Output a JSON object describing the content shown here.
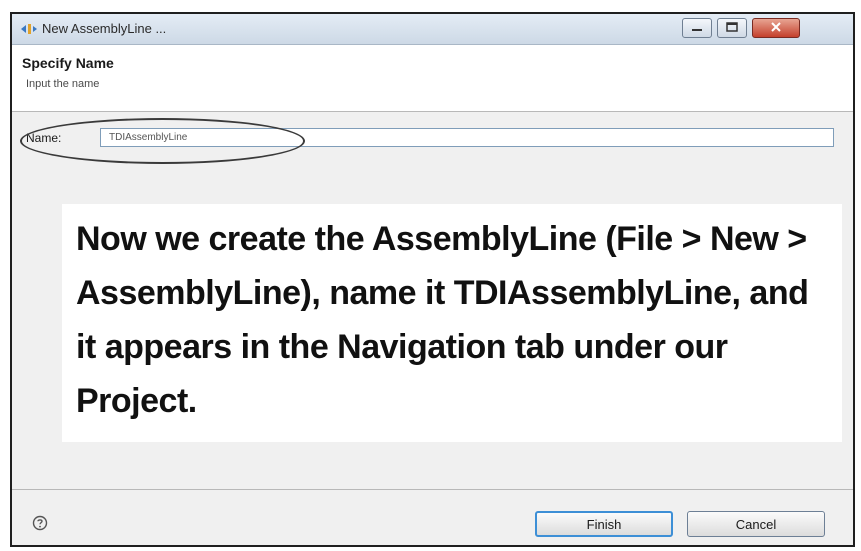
{
  "window": {
    "title": "New AssemblyLine ..."
  },
  "header": {
    "title": "Specify Name",
    "subtitle": "Input the name"
  },
  "form": {
    "name_label": "Name:",
    "name_value": "TDIAssemblyLine"
  },
  "annotation": {
    "text": "Now we create the AssemblyLine (File > New > AssemblyLine), name it TDIAssemblyLine, and it appears in the Navigation tab under our Project."
  },
  "footer": {
    "finish_label": "Finish",
    "cancel_label": "Cancel"
  },
  "icons": {
    "app": "wizard-icon",
    "help": "help-icon",
    "minimize": "minimize-icon",
    "maximize": "maximize-icon",
    "close": "close-icon"
  },
  "colors": {
    "focus_border": "#3d8fd6",
    "close_button": "#c4402c"
  }
}
